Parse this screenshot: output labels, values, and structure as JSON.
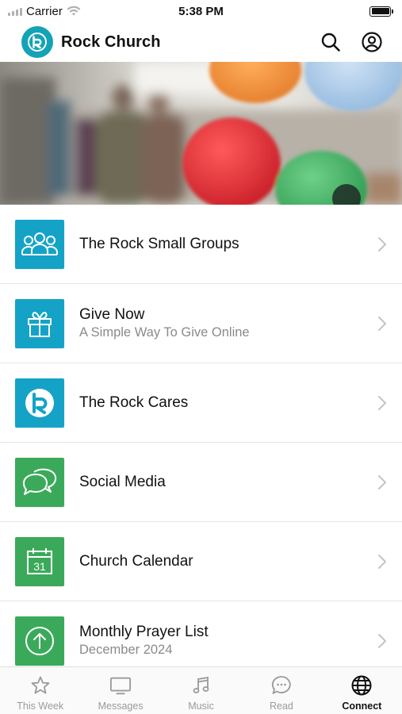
{
  "status_bar": {
    "carrier": "Carrier",
    "time": "5:38 PM"
  },
  "header": {
    "title": "Rock Church"
  },
  "hero": {
    "icon": "hero-photo-balloons"
  },
  "colors": {
    "accent_blue": "#14a3c6",
    "accent_green": "#3aaa5a",
    "logo_teal": "#14a3b6"
  },
  "list": [
    {
      "title": "The Rock Small Groups",
      "subtitle": "",
      "icon": "people-group-icon",
      "color": "blue"
    },
    {
      "title": "Give Now",
      "subtitle": "A Simple Way To Give Online",
      "icon": "gift-icon",
      "color": "blue"
    },
    {
      "title": "The Rock Cares",
      "subtitle": "",
      "icon": "rock-logo-icon",
      "color": "blue"
    },
    {
      "title": "Social Media",
      "subtitle": "",
      "icon": "chat-bubbles-icon",
      "color": "green"
    },
    {
      "title": "Church Calendar",
      "subtitle": "",
      "icon": "calendar-icon",
      "color": "green",
      "icon_text": "31"
    },
    {
      "title": "Monthly Prayer List",
      "subtitle": "December 2024",
      "icon": "arrow-up-circle-icon",
      "color": "green"
    }
  ],
  "tabs": [
    {
      "label": "This Week",
      "icon": "star-icon",
      "active": false
    },
    {
      "label": "Messages",
      "icon": "tv-icon",
      "active": false
    },
    {
      "label": "Music",
      "icon": "music-note-icon",
      "active": false
    },
    {
      "label": "Read",
      "icon": "speech-bubble-icon",
      "active": false
    },
    {
      "label": "Connect",
      "icon": "globe-icon",
      "active": true
    }
  ]
}
